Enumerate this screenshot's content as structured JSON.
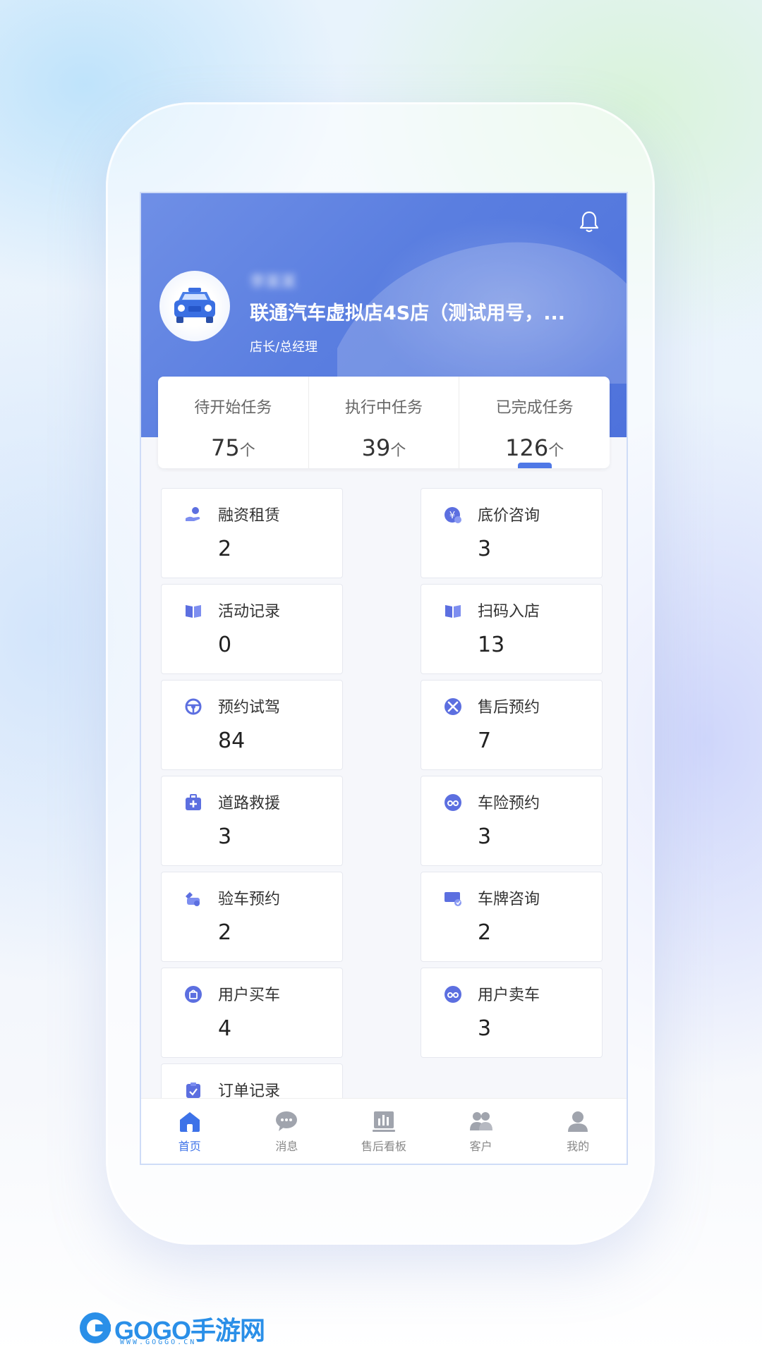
{
  "header": {
    "username": "李某某",
    "store_name": "联通汽车虚拟店4S店（测试用号，...",
    "role": "店长/总经理"
  },
  "stats": [
    {
      "label": "待开始任务",
      "value": "75",
      "unit": "个"
    },
    {
      "label": "执行中任务",
      "value": "39",
      "unit": "个"
    },
    {
      "label": "已完成任务",
      "value": "126",
      "unit": "个"
    }
  ],
  "cards": [
    {
      "title": "融资租赁",
      "value": "2",
      "icon": "finance-lease-icon"
    },
    {
      "title": "底价咨询",
      "value": "3",
      "icon": "price-inquiry-icon"
    },
    {
      "title": "活动记录",
      "value": "0",
      "icon": "activity-book-icon"
    },
    {
      "title": "扫码入店",
      "value": "13",
      "icon": "scan-book-icon"
    },
    {
      "title": "预约试驾",
      "value": "84",
      "icon": "steering-wheel-icon"
    },
    {
      "title": "售后预约",
      "value": "7",
      "icon": "tools-icon"
    },
    {
      "title": "道路救援",
      "value": "3",
      "icon": "first-aid-icon"
    },
    {
      "title": "车险预约",
      "value": "3",
      "icon": "car-insurance-icon"
    },
    {
      "title": "验车预约",
      "value": "2",
      "icon": "car-inspection-icon"
    },
    {
      "title": "车牌咨询",
      "value": "2",
      "icon": "license-plate-icon"
    },
    {
      "title": "用户买车",
      "value": "4",
      "icon": "shopping-bag-icon"
    },
    {
      "title": "用户卖车",
      "value": "3",
      "icon": "sell-car-icon"
    },
    {
      "title": "订单记录",
      "value": "",
      "icon": "clipboard-icon"
    }
  ],
  "tabs": [
    {
      "label": "首页",
      "icon": "home-icon",
      "active": true
    },
    {
      "label": "消息",
      "icon": "message-icon",
      "active": false
    },
    {
      "label": "售后看板",
      "icon": "dashboard-icon",
      "active": false
    },
    {
      "label": "客户",
      "icon": "customers-icon",
      "active": false
    },
    {
      "label": "我的",
      "icon": "profile-icon",
      "active": false
    }
  ],
  "watermark": {
    "brand": "GOGO手游网",
    "url": "WWW.GOGGO.CN"
  },
  "colors": {
    "accent": "#4f78e6",
    "banner": "#5a7ee0",
    "tab_active": "#3d72e8",
    "icon": "#5c6fe0"
  }
}
